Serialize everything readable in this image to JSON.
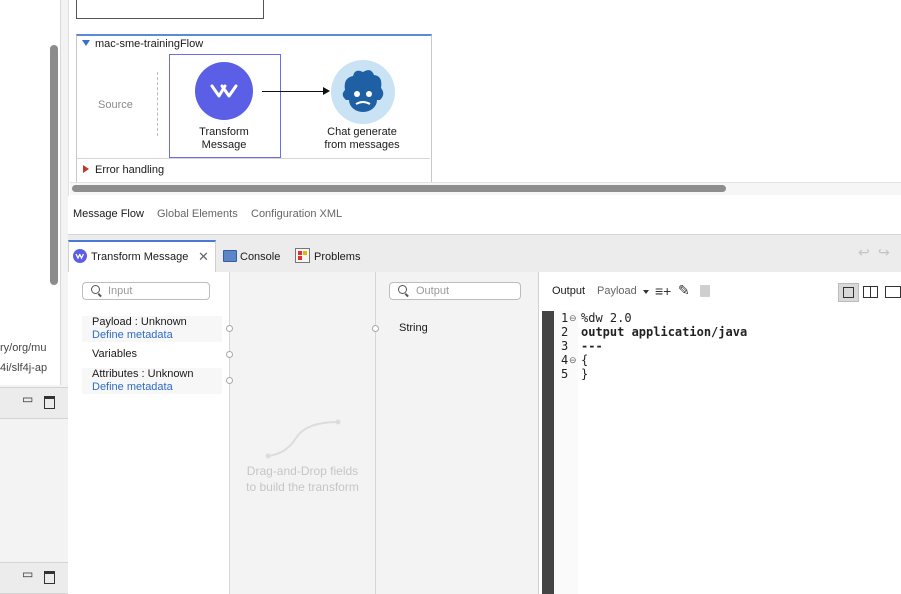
{
  "left_panel": {
    "path_line_1": "ry/org/mu",
    "path_line_2": "4i/slf4j-ap",
    "minimize_icon": "minimize-icon",
    "maximize_icon": "maximize-icon"
  },
  "canvas": {
    "flow_name": "mac-sme-trainingFlow",
    "source_label": "Source",
    "transform_component": {
      "line1": "Transform",
      "line2": "Message",
      "icon": "dataweave-icon"
    },
    "chat_component": {
      "line1": "Chat generate",
      "line2": "from messages",
      "icon": "einstein-icon"
    },
    "error_handling_label": "Error handling"
  },
  "editor_tabs": [
    {
      "label": "Message Flow",
      "active": true
    },
    {
      "label": "Global Elements",
      "active": false
    },
    {
      "label": "Configuration XML",
      "active": false
    }
  ],
  "view_tabs": [
    {
      "label": "Transform Message",
      "active": true
    },
    {
      "label": "Console",
      "active": false
    },
    {
      "label": "Problems",
      "active": false
    }
  ],
  "transform": {
    "input_search_placeholder": "Input",
    "output_search_placeholder": "Output",
    "inputs": [
      {
        "label": "Payload : Unknown",
        "link": "Define metadata"
      },
      {
        "label": "Variables"
      },
      {
        "label": "Attributes : Unknown",
        "link": "Define metadata"
      }
    ],
    "drag_hint_line1": "Drag-and-Drop fields",
    "drag_hint_line2": "to build the transform",
    "output_type": "String",
    "output_header": "Output",
    "output_target": "Payload",
    "code": [
      {
        "num": "1",
        "fold": "⊖",
        "text": "%dw 2.0",
        "bold": false
      },
      {
        "num": "2",
        "fold": "",
        "text": "output application/java",
        "bold": true
      },
      {
        "num": "3",
        "fold": "",
        "text": "---",
        "bold": true
      },
      {
        "num": "4",
        "fold": "⊖",
        "text": "{",
        "bold": false
      },
      {
        "num": "5",
        "fold": "",
        "text": "}",
        "bold": false
      }
    ]
  },
  "colors": {
    "accent": "#5a5fe6",
    "link": "#2f6cc7",
    "tab_active_border": "#4a7ad6"
  }
}
